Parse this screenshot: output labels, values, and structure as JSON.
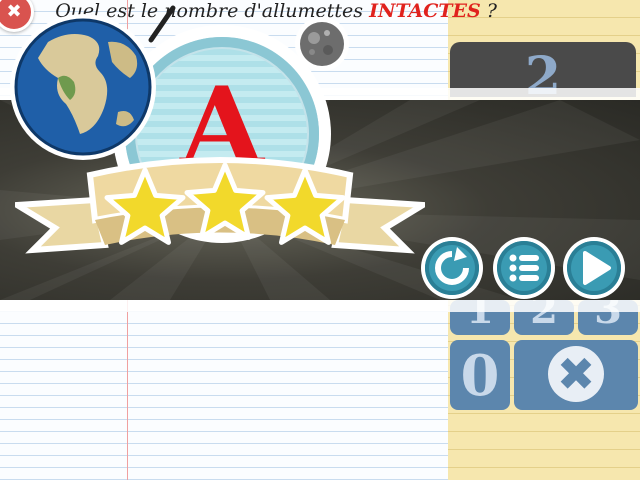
{
  "question": {
    "prefix": "Quel est le nombre d'allumettes",
    "highlight": "INTACTES",
    "suffix": "?"
  },
  "answer_display": "2",
  "result": {
    "grade": "A",
    "stars": 3
  },
  "keypad": {
    "key_1": "1",
    "key_2": "2",
    "key_3": "3",
    "key_0": "0",
    "delete_symbol": "✖"
  },
  "close_symbol": "✖",
  "colors": {
    "grade_red": "#e4141c",
    "highlight_red": "#e0221d",
    "star_yellow": "#f2d92b",
    "button_teal": "#3a9bb3",
    "keypad_blue": "#5c86ad"
  },
  "icons": [
    "close-icon",
    "earth-icon",
    "moon-icon",
    "replay-icon",
    "menu-list-icon",
    "play-next-icon",
    "delete-icon"
  ]
}
